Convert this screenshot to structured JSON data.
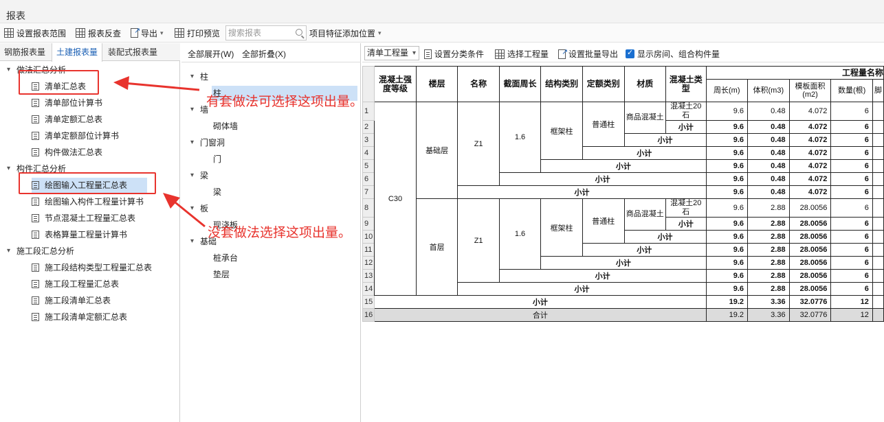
{
  "window": {
    "title": "报表"
  },
  "toolbar": {
    "set_range": "设置报表范围",
    "reverse_check": "报表反查",
    "export": "导出",
    "print_preview": "打印预览",
    "search_placeholder": "搜索报表",
    "feature_position": "项目特征添加位置"
  },
  "left_tabs": [
    "钢筋报表量",
    "土建报表量",
    "装配式报表量"
  ],
  "tree": {
    "g1": "做法汇总分析",
    "g1_items": [
      "清单汇总表",
      "清单部位计算书",
      "清单定额汇总表",
      "清单定额部位计算书",
      "构件做法汇总表"
    ],
    "g2": "构件汇总分析",
    "g2_items": [
      "绘图输入工程量汇总表",
      "绘图输入构件工程量计算书",
      "节点混凝土工程量汇总表",
      "表格算量工程量计算书"
    ],
    "g3": "施工段汇总分析",
    "g3_items": [
      "施工段结构类型工程量汇总表",
      "施工段工程量汇总表",
      "施工段清单汇总表",
      "施工段清单定额汇总表"
    ]
  },
  "mid": {
    "expand_all": "全部展开(W)",
    "collapse_all": "全部折叠(X)",
    "items": [
      "柱",
      "柱",
      "墙",
      "砌体墙",
      "门窗洞",
      "门",
      "梁",
      "梁",
      "板",
      "现浇板",
      "基础",
      "桩承台",
      "垫层"
    ]
  },
  "right": {
    "dropdown": "清单工程量",
    "set_category": "设置分类条件",
    "select_qty": "选择工程量",
    "batch_export": "设置批量导出",
    "show_rooms": "显示房间、组合构件量"
  },
  "table": {
    "headers": {
      "grade": "混凝土强度等级",
      "floor": "楼层",
      "name": "名称",
      "perimeter": "截面周长",
      "struct": "结构类别",
      "quota": "定额类别",
      "material": "材质",
      "conc": "混凝土类型",
      "group": "工程量名称",
      "c1": "周长(m)",
      "c2": "体积(m3)",
      "c3": "模板面积(m2)",
      "c4": "数量(根)",
      "c5": "脚"
    },
    "grade": "C30",
    "floor1": "基础层",
    "floor2": "首层",
    "name": "Z1",
    "perimeter": "1.6",
    "struct": "框架柱",
    "quota": "普通柱",
    "material": "商品混凝土",
    "conc": "混凝土20石",
    "subtotal": "小计",
    "total": "合计",
    "row_numbers": [
      "1",
      "2",
      "3",
      "4",
      "5",
      "6",
      "7",
      "8",
      "9",
      "10",
      "11",
      "12",
      "13",
      "14",
      "15",
      "16"
    ],
    "floor1_values": [
      "9.6",
      "0.48",
      "4.072",
      "6"
    ],
    "floor2_values": [
      "9.6",
      "2.88",
      "28.0056",
      "6"
    ],
    "floor_sum_values": [
      "19.2",
      "3.36",
      "32.0776",
      "12"
    ],
    "total_values": [
      "19.2",
      "3.36",
      "32.0776",
      "12"
    ]
  },
  "annotations": {
    "note1": "有套做法可选择这项出量。",
    "note2": "没套做法选择这项出量。"
  },
  "colors": {
    "annotation": "#e8332d",
    "selection": "#cde1f7",
    "accent": "#1a6fd0"
  }
}
